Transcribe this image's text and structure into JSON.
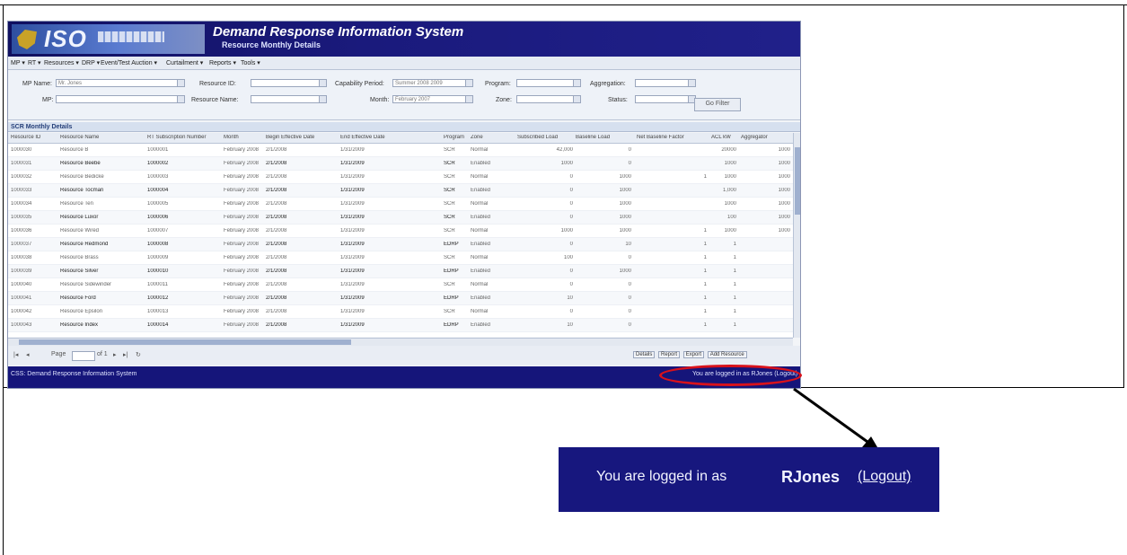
{
  "app": {
    "title": "Demand Response Information System",
    "subtitle": "Resource Monthly Details",
    "logo_text": "ISO"
  },
  "menu": {
    "items": [
      "MP ▾",
      "RT ▾",
      "Resources ▾",
      "DRP ▾",
      "Event/Test Auction ▾",
      "Curtailment ▾",
      "Reports ▾",
      "Tools ▾"
    ]
  },
  "filters": {
    "mp_name_label": "MP Name:",
    "mp_name_value": "Mr. Jones",
    "mp_label": "MP:",
    "resource_id_label": "Resource ID:",
    "resource_name_label": "Resource Name:",
    "capability_period_label": "Capability Period:",
    "capability_period_value": "Summer 2008 2009",
    "month_label": "Month:",
    "month_value": "February 2007",
    "program_label": "Program:",
    "zone_label": "Zone:",
    "aggregation_label": "Aggregation:",
    "status_label": "Status:",
    "filter_button": "Go Filter"
  },
  "grid": {
    "title": "SCR Monthly Details",
    "columns": [
      "Resource ID",
      "Resource Name",
      "RT Subscription Number",
      "Month",
      "Begin Effective Date",
      "End Effective Date",
      "Program",
      "Zone",
      "Subscribed Load",
      "Baseline Load",
      "Net Baseline Factor",
      "ACL kW",
      "Aggregator"
    ],
    "rows": [
      [
        "1000030",
        "Resource B",
        "1000001",
        "February 2008",
        "2/1/2008",
        "1/31/2009",
        "SCR",
        "Normal",
        "42,000",
        "0",
        "",
        "20000",
        "1000"
      ],
      [
        "1000031",
        "Resource Beebe",
        "1000002",
        "February 2008",
        "2/1/2008",
        "1/31/2009",
        "SCR",
        "Enabled",
        "1000",
        "0",
        "",
        "1000",
        "1000"
      ],
      [
        "1000032",
        "Resource Bedicke",
        "1000003",
        "February 2008",
        "2/1/2008",
        "1/31/2009",
        "SCR",
        "Normal",
        "0",
        "1000",
        "1",
        "1000",
        "1000"
      ],
      [
        "1000033",
        "Resource Tocman",
        "1000004",
        "February 2008",
        "2/1/2008",
        "1/31/2009",
        "SCR",
        "Enabled",
        "0",
        "1000",
        "",
        "1,000",
        "1000"
      ],
      [
        "1000034",
        "Resource Ten",
        "1000005",
        "February 2008",
        "2/1/2008",
        "1/31/2009",
        "SCR",
        "Normal",
        "0",
        "1000",
        "",
        "1000",
        "1000"
      ],
      [
        "1000035",
        "Resource Luxor",
        "1000006",
        "February 2008",
        "2/1/2008",
        "1/31/2009",
        "SCR",
        "Enabled",
        "0",
        "1000",
        "",
        "100",
        "1000"
      ],
      [
        "1000036",
        "Resource Wired",
        "1000007",
        "February 2008",
        "2/1/2008",
        "1/31/2009",
        "SCR",
        "Normal",
        "1000",
        "1000",
        "1",
        "1000",
        "1000"
      ],
      [
        "1000037",
        "Resource Redmond",
        "1000008",
        "February 2008",
        "2/1/2008",
        "1/31/2009",
        "EDRP",
        "Enabled",
        "0",
        "10",
        "1",
        "1",
        ""
      ],
      [
        "1000038",
        "Resource Brass",
        "1000009",
        "February 2008",
        "2/1/2008",
        "1/31/2009",
        "SCR",
        "Normal",
        "100",
        "0",
        "1",
        "1",
        ""
      ],
      [
        "1000039",
        "Resource Silver",
        "1000010",
        "February 2008",
        "2/1/2008",
        "1/31/2009",
        "EDRP",
        "Enabled",
        "0",
        "1000",
        "1",
        "1",
        ""
      ],
      [
        "1000040",
        "Resource Sidewinder",
        "1000011",
        "February 2008",
        "2/1/2008",
        "1/31/2009",
        "SCR",
        "Normal",
        "0",
        "0",
        "1",
        "1",
        ""
      ],
      [
        "1000041",
        "Resource Ford",
        "1000012",
        "February 2008",
        "2/1/2008",
        "1/31/2009",
        "EDRP",
        "Enabled",
        "10",
        "0",
        "1",
        "1",
        ""
      ],
      [
        "1000042",
        "Resource Epsilon",
        "1000013",
        "February 2008",
        "2/1/2008",
        "1/31/2009",
        "SCR",
        "Normal",
        "0",
        "0",
        "1",
        "1",
        ""
      ],
      [
        "1000043",
        "Resource Index",
        "1000014",
        "February 2008",
        "2/1/2008",
        "1/31/2009",
        "EDRP",
        "Enabled",
        "10",
        "0",
        "1",
        "1",
        ""
      ]
    ]
  },
  "pager": {
    "page_label": "Page",
    "of_label": "of 1",
    "buttons": [
      "Details",
      "Report",
      "Export",
      "Add Resource"
    ]
  },
  "status": {
    "left": "CSS: Demand Response Information System",
    "right": "You are logged in as RJones (Logout)"
  },
  "zoom": {
    "logged_in_text": "You are logged in as",
    "username": "RJones",
    "logout_text": "(Logout)"
  },
  "colors": {
    "banner": "#15157a",
    "highlight": "#d8121b"
  }
}
